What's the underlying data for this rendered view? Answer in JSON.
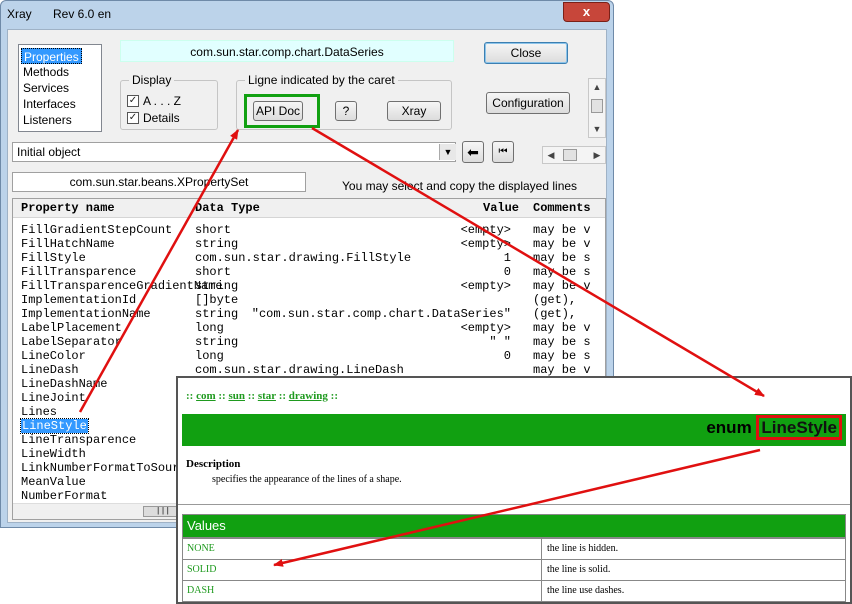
{
  "window": {
    "title": "Xray",
    "version": "Rev 6.0 en",
    "close_glyph": "x"
  },
  "tabs": [
    "Properties",
    "Methods",
    "Services",
    "Interfaces",
    "Listeners"
  ],
  "object_type": "com.sun.star.comp.chart.DataSeries",
  "display": {
    "label": "Display",
    "az_label": "A . . . Z",
    "details_label": "Details"
  },
  "caret_group": {
    "label": "Ligne indicated by the caret",
    "api_doc": "API Doc",
    "help": "?",
    "xray": "Xray"
  },
  "buttons": {
    "close": "Close",
    "configuration": "Configuration"
  },
  "history": {
    "value": "Initial object"
  },
  "interface_field": "com.sun.star.beans.XPropertySet",
  "hint": "You may select and copy the displayed lines",
  "table": {
    "headers": {
      "name": "Property name",
      "type": "Data Type",
      "value": "Value",
      "comments": "Comments"
    },
    "rows": [
      {
        "name": "FillGradientStepCount",
        "type": "short",
        "value": "<empty>",
        "comment": "may be v"
      },
      {
        "name": "FillHatchName",
        "type": "string",
        "value": "<empty>",
        "comment": "may be v"
      },
      {
        "name": "FillStyle",
        "type": "com.sun.star.drawing.FillStyle",
        "value": "1",
        "comment": "may be s"
      },
      {
        "name": "FillTransparence",
        "type": "short",
        "value": "0",
        "comment": "may be s"
      },
      {
        "name": "FillTransparenceGradientName",
        "type": "string",
        "value": "<empty>",
        "comment": "may be v"
      },
      {
        "name": "ImplementationId",
        "type": "[]byte",
        "value": "",
        "comment": "(get), "
      },
      {
        "name": "ImplementationName",
        "type": "string",
        "value": "\"com.sun.star.comp.chart.DataSeries\"",
        "comment": "(get), "
      },
      {
        "name": "LabelPlacement",
        "type": "long",
        "value": "<empty>",
        "comment": "may be v"
      },
      {
        "name": "LabelSeparator",
        "type": "string",
        "value": "\" \"",
        "comment": "may be s"
      },
      {
        "name": "LineColor",
        "type": "long",
        "value": "0",
        "comment": "may be s"
      },
      {
        "name": "LineDash",
        "type": "com.sun.star.drawing.LineDash",
        "value": "",
        "comment": "may be v"
      },
      {
        "name": "LineDashName",
        "type": "",
        "value": "",
        "comment": ""
      },
      {
        "name": "LineJoint",
        "type": "",
        "value": "",
        "comment": ""
      },
      {
        "name": "Lines",
        "type": "",
        "value": "",
        "comment": ""
      },
      {
        "name": "LineStyle",
        "type": "",
        "value": "",
        "comment": ""
      },
      {
        "name": "LineTransparence",
        "type": "",
        "value": "",
        "comment": ""
      },
      {
        "name": "LineWidth",
        "type": "",
        "value": "",
        "comment": ""
      },
      {
        "name": "LinkNumberFormatToSource",
        "type": "",
        "value": "",
        "comment": ""
      },
      {
        "name": "MeanValue",
        "type": "",
        "value": "",
        "comment": ""
      },
      {
        "name": "NumberFormat",
        "type": "",
        "value": "",
        "comment": ""
      }
    ]
  },
  "doc": {
    "breadcrumb": {
      "sep": "::",
      "parts": [
        "com",
        "sun",
        "star",
        "drawing"
      ]
    },
    "title_prefix": "enum ",
    "title_name": "LineStyle",
    "description_heading": "Description",
    "description_text": "specifies the appearance of the lines of a shape.",
    "values_heading": "Values",
    "values": [
      {
        "name": "NONE",
        "desc": "the line is hidden."
      },
      {
        "name": "SOLID",
        "desc": "the line is solid."
      },
      {
        "name": "DASH",
        "desc": "the line use dashes."
      }
    ]
  },
  "colors": {
    "accent_green": "#11a011",
    "highlight_red": "#e01010",
    "window_frame": "#bcd3ea"
  }
}
